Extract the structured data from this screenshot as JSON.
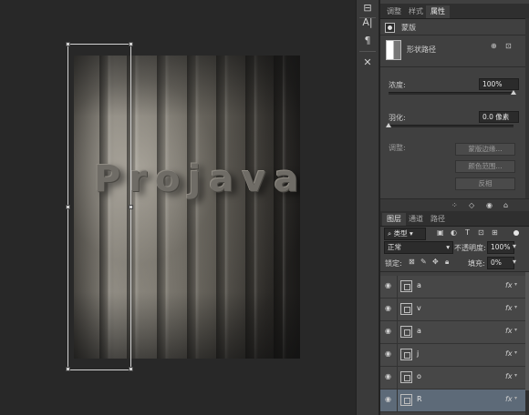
{
  "canvas": {
    "word_letters": [
      "P",
      "r",
      "o",
      "j",
      "a",
      "v",
      "a"
    ]
  },
  "tools": [
    {
      "name": "align-icon",
      "glyph": "⊟"
    },
    {
      "name": "character-icon",
      "glyph": "A|"
    },
    {
      "name": "paragraph-icon",
      "glyph": "¶"
    },
    {
      "name": "transform-tools-icon",
      "glyph": "✕"
    }
  ],
  "properties": {
    "tabs": [
      "调整",
      "样式",
      "属性"
    ],
    "active_tab": "属性",
    "panel_title": "蒙版",
    "mask_type": "形状路径",
    "density_label": "浓度:",
    "density_value": "100%",
    "density_fraction": 1.0,
    "feather_label": "羽化:",
    "feather_value": "0.0 像素",
    "feather_fraction": 0.0,
    "adjust_label": "调整:",
    "buttons": [
      "蒙版边缘...",
      "颜色范围...",
      "反相"
    ]
  },
  "layers": {
    "tabs": [
      "图层",
      "通道",
      "路径"
    ],
    "active_tab": "图层",
    "filter_label": "类型",
    "blend_mode": "正常",
    "opacity_label": "不透明度:",
    "opacity_value": "100%",
    "lock_label": "锁定:",
    "fill_label": "填充:",
    "fill_value": "0%",
    "rows": [
      {
        "name": "a",
        "fx": "fx",
        "selected": false
      },
      {
        "name": "v",
        "fx": "fx",
        "selected": false
      },
      {
        "name": "a",
        "fx": "fx",
        "selected": false
      },
      {
        "name": "j",
        "fx": "fx",
        "selected": false
      },
      {
        "name": "o",
        "fx": "fx",
        "selected": false
      },
      {
        "name": "R",
        "fx": "fx",
        "selected": true
      }
    ]
  },
  "colors": {
    "app_bg": "#282828",
    "panel_bg": "#404040",
    "selected_layer": "#5d6a78"
  }
}
